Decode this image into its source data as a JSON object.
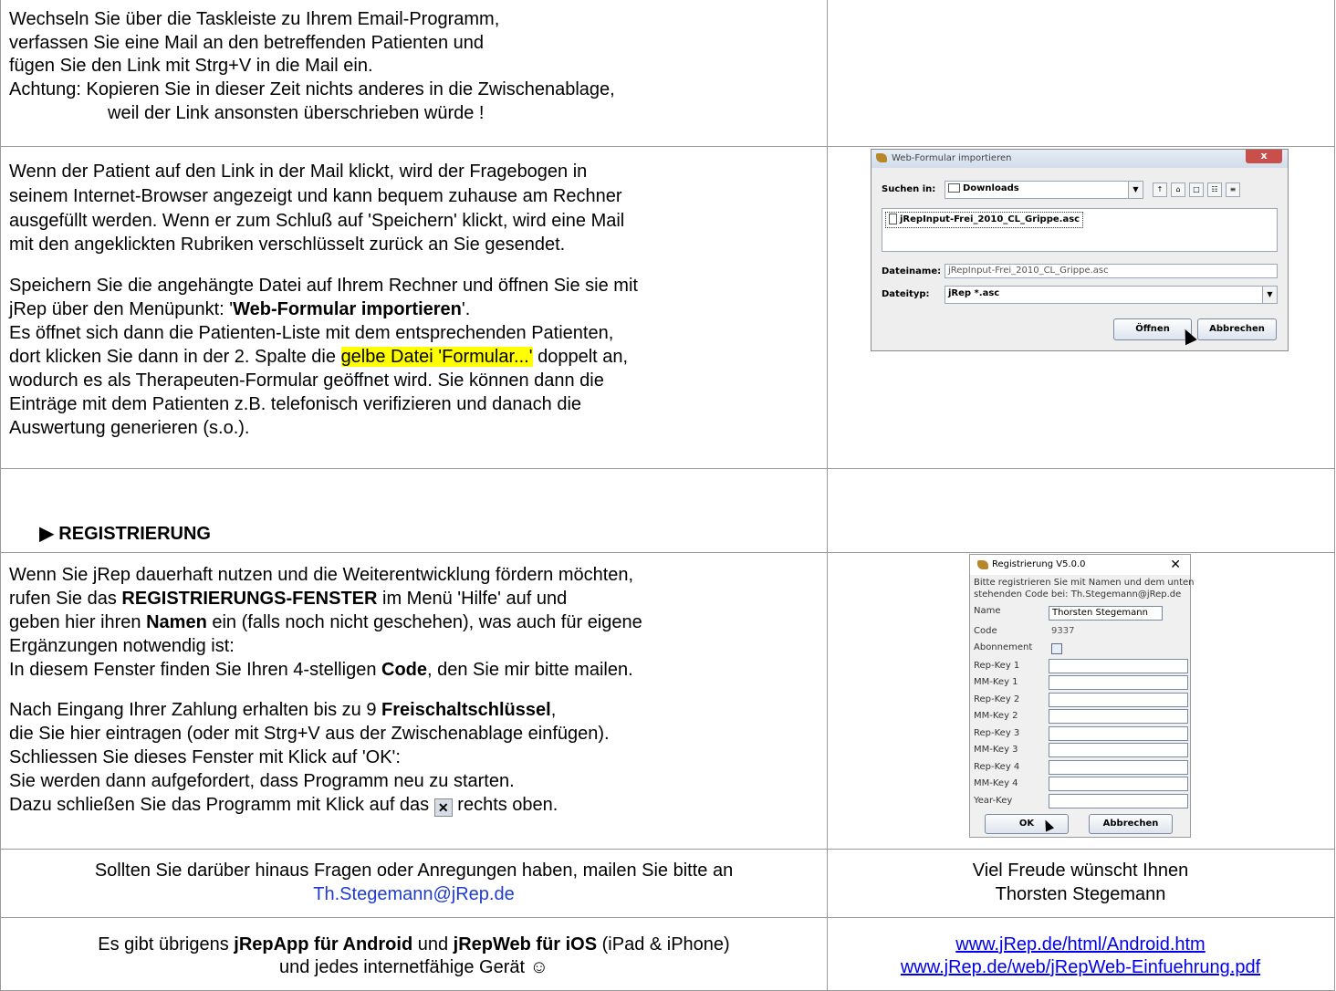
{
  "row1": {
    "lines": [
      "Wechseln Sie über die Taskleiste zu Ihrem Email-Programm,",
      "verfassen Sie eine Mail an den betreffenden Patienten und",
      "fügen Sie den Link mit Strg+V in die Mail ein.",
      "Achtung: Kopieren Sie in dieser Zeit nichts anderes in die Zwischenablage,",
      "weil der Link ansonsten überschrieben würde !"
    ]
  },
  "row2": {
    "p1": [
      "Wenn der Patient auf den Link in der Mail klickt, wird der Fragebogen in",
      "seinem Internet-Browser angezeigt und kann bequem zuhause am Rechner",
      "ausgefüllt werden. Wenn er zum Schluß auf 'Speichern' klickt, wird eine Mail",
      "mit den angeklickten Rubriken verschlüsselt zurück an Sie gesendet."
    ],
    "p2_line1": "Speichern Sie die angehängte Datei auf Ihrem Rechner und öffnen Sie sie mit",
    "p2_line2_pre": "jRep über den Menüpunkt: '",
    "p2_line2_bold": "Web-Formular importieren",
    "p2_line2_post": "'.",
    "p2_line3": "Es öffnet sich dann die Patienten-Liste mit dem entsprechenden Patienten,",
    "p2_line4_pre": "dort klicken Sie dann in der 2. Spalte die ",
    "p2_line4_hl": "gelbe Datei 'Formular...'",
    "p2_line4_post": " doppelt an,",
    "p2_line5": "wodurch es als Therapeuten-Formular geöffnet wird. Sie können dann die",
    "p2_line6": "Einträge mit dem Patienten z.B. telefonisch verifizieren und danach die",
    "p2_line7": "Auswertung generieren (s.o.)."
  },
  "dialog_import": {
    "title": "Web-Formular importieren",
    "close": "x",
    "look_in_label": "Suchen in:",
    "look_in_value": "Downloads",
    "file_item": "jRepInput-Frei_2010_CL_Grippe.asc",
    "filename_label": "Dateiname:",
    "filename_value": "jRepInput-Frei_2010_CL_Grippe.asc",
    "filetype_label": "Dateityp:",
    "filetype_value": "jRep  *.asc",
    "open_button": "Öffnen",
    "cancel_button": "Abbrechen"
  },
  "section": {
    "arrow": "▶",
    "heading": "REGISTRIERUNG"
  },
  "row4": {
    "l1": "Wenn Sie jRep dauerhaft nutzen und die Weiterentwicklung fördern möchten,",
    "l2_pre": "rufen Sie das ",
    "l2_bold": "REGISTRIERUNGS-FENSTER",
    "l2_post": " im Menü 'Hilfe' auf und",
    "l3_pre": "geben hier ihren ",
    "l3_bold": "Namen",
    "l3_post": " ein (falls noch nicht geschehen), was auch für eigene",
    "l4": "Ergänzungen notwendig ist:",
    "l5_pre": "In diesem Fenster finden Sie Ihren 4-stelligen ",
    "l5_bold": "Code",
    "l5_post": ", den Sie mir bitte mailen.",
    "l6_pre": "Nach Eingang Ihrer Zahlung erhalten bis zu 9 ",
    "l6_bold": "Freischaltschlüssel",
    "l6_post": ",",
    "l7": "die Sie hier eintragen (oder mit Strg+V aus der Zwischenablage einfügen).",
    "l8": "Schliessen Sie dieses Fenster mit Klick auf 'OK':",
    "l9": "Sie werden dann aufgefordert, dass Programm neu zu starten.",
    "l10_pre": "Dazu schließen Sie das Programm mit Klick auf das ",
    "l10_icon": "✕",
    "l10_post": " rechts oben."
  },
  "dialog_reg": {
    "title": "Registrierung V5.0.0",
    "close": "✕",
    "intro1": "Bitte registrieren Sie mit Namen und dem unten",
    "intro2": "stehenden Code bei: Th.Stegemann@jRep.de",
    "name_label": "Name",
    "name_value": "Thorsten Stegemann",
    "code_label": "Code",
    "code_value": "9337",
    "abo_label": "Abonnement",
    "keys": [
      "Rep-Key 1",
      "MM-Key 1",
      "Rep-Key 2",
      "MM-Key 2",
      "Rep-Key 3",
      "MM-Key 3",
      "Rep-Key 4",
      "MM-Key 4",
      "Year-Key"
    ],
    "ok_button": "OK",
    "cancel_button": "Abbrechen"
  },
  "row5": {
    "left1": "Sollten Sie darüber hinaus Fragen oder Anregungen haben, mailen Sie bitte an",
    "left2": "Th.Stegemann@jRep.de",
    "right1": "Viel Freude wünscht Ihnen",
    "right2": "Thorsten Stegemann"
  },
  "row6": {
    "l1_pre": "Es gibt übrigens ",
    "l1_b1": "jRepApp für Android",
    "l1_mid": " und ",
    "l1_b2": "jRepWeb für iOS",
    "l1_post": " (iPad & iPhone)",
    "l2": "und jedes internetfähige Gerät ☺",
    "link1": "www.jRep.de/html/Android.htm",
    "link2": "www.jRep.de/web/jRepWeb-Einfuehrung.pdf"
  },
  "colors": {
    "highlight": "#ffff00",
    "link": "#0000ee",
    "border": "#9a9a9a"
  }
}
